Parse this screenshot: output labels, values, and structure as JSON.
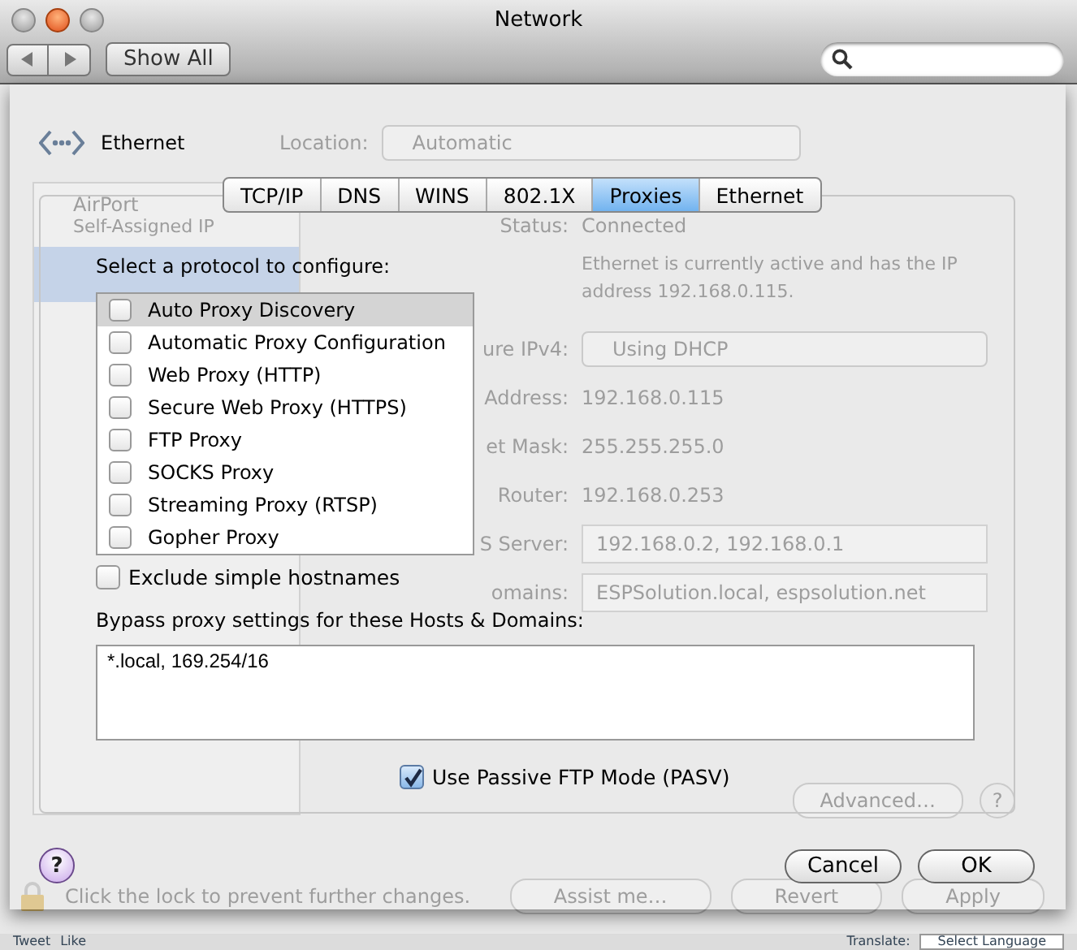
{
  "window": {
    "title": "Network"
  },
  "toolbar": {
    "show_all": "Show All"
  },
  "background": {
    "location_label": "Location:",
    "location": "Automatic",
    "services": [
      {
        "name": "AirPort",
        "status": "Self-Assigned IP",
        "selected": false
      },
      {
        "selected": true
      }
    ],
    "status_label": "Status:",
    "status": "Connected",
    "status_text": "Ethernet is currently active and has the IP address 192.168.0.115.",
    "fields": [
      {
        "label": "ure IPv4:",
        "value": "Using DHCP",
        "kind": "popup"
      },
      {
        "label": "Address:",
        "value": "192.168.0.115",
        "kind": "text"
      },
      {
        "label": "et Mask:",
        "value": "255.255.255.0",
        "kind": "text"
      },
      {
        "label": "Router:",
        "value": "192.168.0.253",
        "kind": "text"
      },
      {
        "label": "S Server:",
        "value": "192.168.0.2, 192.168.0.1",
        "kind": "field"
      },
      {
        "label": "omains:",
        "value": "ESPSolution.local, espsolution.net",
        "kind": "field"
      }
    ],
    "advanced": "Advanced…",
    "help": "?",
    "lock_text": "Click the lock to prevent further changes.",
    "buttons": [
      "Assist me…",
      "Revert",
      "Apply"
    ]
  },
  "sheet": {
    "service": "Ethernet",
    "tabs": [
      {
        "label": "TCP/IP",
        "selected": false
      },
      {
        "label": "DNS",
        "selected": false
      },
      {
        "label": "WINS",
        "selected": false
      },
      {
        "label": "802.1X",
        "selected": false
      },
      {
        "label": "Proxies",
        "selected": true
      },
      {
        "label": "Ethernet",
        "selected": false
      }
    ],
    "protocol_label": "Select a protocol to configure:",
    "protocols": [
      {
        "label": "Auto Proxy Discovery",
        "checked": false,
        "selected": true
      },
      {
        "label": "Automatic Proxy Configuration",
        "checked": false,
        "selected": false
      },
      {
        "label": "Web Proxy (HTTP)",
        "checked": false,
        "selected": false
      },
      {
        "label": "Secure Web Proxy (HTTPS)",
        "checked": false,
        "selected": false
      },
      {
        "label": "FTP Proxy",
        "checked": false,
        "selected": false
      },
      {
        "label": "SOCKS Proxy",
        "checked": false,
        "selected": false
      },
      {
        "label": "Streaming Proxy (RTSP)",
        "checked": false,
        "selected": false
      },
      {
        "label": "Gopher Proxy",
        "checked": false,
        "selected": false
      }
    ],
    "exclude_simple": {
      "label": "Exclude simple hostnames",
      "checked": false
    },
    "bypass_label": "Bypass proxy settings for these Hosts & Domains:",
    "bypass": "*.local, 169.254/16",
    "passive_ftp": {
      "label": "Use Passive FTP Mode (PASV)",
      "checked": true
    },
    "help": "?",
    "buttons": [
      "Cancel",
      "OK"
    ]
  },
  "page_strip": {
    "tweet": "Tweet",
    "like": "Like",
    "translate_label": "Translate:",
    "language": "Select Language"
  }
}
